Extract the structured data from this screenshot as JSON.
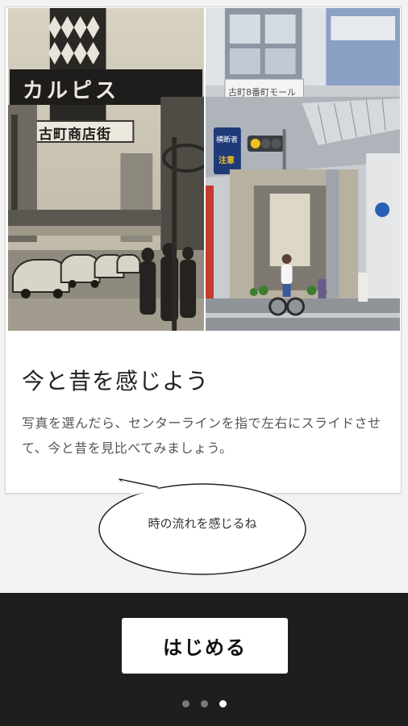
{
  "photos": {
    "old": {
      "sign_katakana": "カルピス",
      "sign_shop": "古町商店街",
      "sign_small": "古町商店街"
    },
    "now": {
      "sign_arcade": "古町8番町モール",
      "sign_traffic_top": "横断者",
      "sign_traffic_bottom": "注意"
    }
  },
  "card": {
    "title": "今と昔を感じよう",
    "description": "写真を選んだら、センターラインを指で左右にスライドさせて、今と昔を見比べてみましょう。"
  },
  "bubble": {
    "text": "時の流れを感じるね"
  },
  "footer": {
    "start_label": "はじめる",
    "pager": {
      "total": 3,
      "current": 3
    }
  },
  "colors": {
    "footer_bg": "#1e1e1e",
    "page_bg": "#f2f2f2",
    "card_bg": "#ffffff"
  }
}
